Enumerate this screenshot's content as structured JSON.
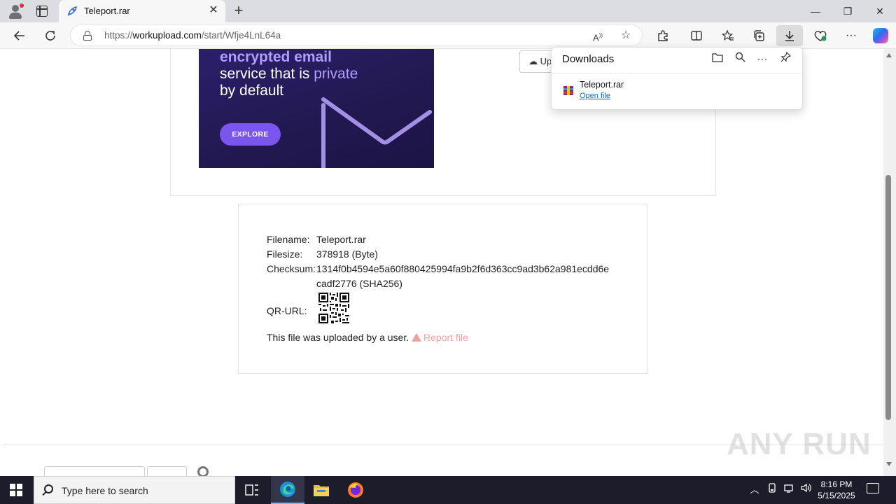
{
  "browser": {
    "tab_title": "Teleport.rar",
    "url_prefix": "https://",
    "url_domain": "workupload.com",
    "url_path": "/start/Wfje4LnL64a"
  },
  "downloads": {
    "title": "Downloads",
    "file_name": "Teleport.rar",
    "open_label": "Open file"
  },
  "ad": {
    "line1": "encrypted email",
    "line2_a": "service that is ",
    "line2_b": "private",
    "line3": "by default",
    "cta": "EXPLORE"
  },
  "page": {
    "upload_label": "Up",
    "filename_label": "Filename:",
    "filename_value": "Teleport.rar",
    "filesize_label": "Filesize:",
    "filesize_value": "378918 (Byte)",
    "checksum_label": "Checksum:",
    "checksum_line1": "1314f0b4594e5a60f880425994fa9b2f6d363cc9ad3b62a981ecdd6e",
    "checksum_line2": "cadf2776 (SHA256)",
    "qr_label": "QR-URL:",
    "uploaded_text": "This file was uploaded by a user.",
    "report_label": "Report file"
  },
  "watermark": "ANY RUN",
  "taskbar": {
    "search_placeholder": "Type here to search",
    "time": "8:16 PM",
    "date": "5/15/2025"
  },
  "colors": {
    "link": "#0f6cbd",
    "report": "#f0a0a0",
    "ad_accent": "#b39cff",
    "ad_button": "#7a55f0"
  }
}
